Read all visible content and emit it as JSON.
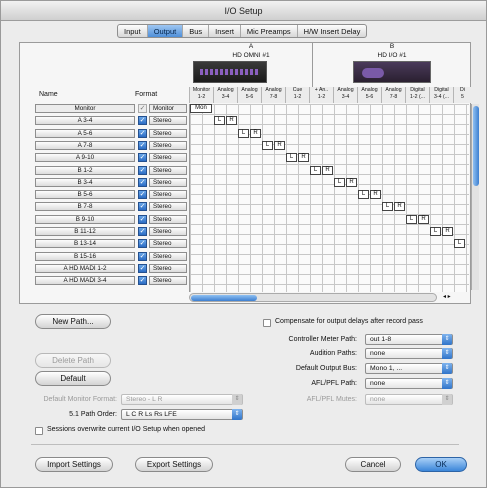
{
  "window": {
    "title": "I/O Setup"
  },
  "tabs": [
    {
      "label": "Input",
      "active": false
    },
    {
      "label": "Output",
      "active": true
    },
    {
      "label": "Bus",
      "active": false
    },
    {
      "label": "Insert",
      "active": false
    },
    {
      "label": "Mic Preamps",
      "active": false
    },
    {
      "label": "H/W Insert Delay",
      "active": false
    }
  ],
  "grid": {
    "name_header": "Name",
    "format_header": "Format",
    "devices": [
      {
        "letter": "A",
        "name": "HD OMNI #1"
      },
      {
        "letter": "B",
        "name": "HD I/O #1"
      }
    ],
    "channels": [
      {
        "l1": "Monitor",
        "l2": "1-2"
      },
      {
        "l1": "Analog",
        "l2": "3-4"
      },
      {
        "l1": "Analog",
        "l2": "5-6"
      },
      {
        "l1": "Analog",
        "l2": "7-8"
      },
      {
        "l1": "Cue",
        "l2": "1-2"
      },
      {
        "l1": "+ An..",
        "l2": "1-2"
      },
      {
        "l1": "Analog",
        "l2": "3-4"
      },
      {
        "l1": "Analog",
        "l2": "5-6"
      },
      {
        "l1": "Analog",
        "l2": "7-8"
      },
      {
        "l1": "Digital",
        "l2": "1-2 (..."
      },
      {
        "l1": "Digital",
        "l2": "3-4 (..."
      },
      {
        "l1": "Di",
        "l2": "5"
      }
    ],
    "rows": [
      {
        "name": "Monitor",
        "format": "Monitor",
        "checked": false,
        "header": true,
        "cells": [
          {
            "col": 0,
            "text": "Mon",
            "wide": true
          }
        ]
      },
      {
        "name": "A 3-4",
        "format": "Stereo",
        "checked": true,
        "cells": [
          {
            "col": 2,
            "text": "L"
          },
          {
            "col": 3,
            "text": "R"
          }
        ]
      },
      {
        "name": "A 5-6",
        "format": "Stereo",
        "checked": true,
        "cells": [
          {
            "col": 4,
            "text": "L"
          },
          {
            "col": 5,
            "text": "R"
          }
        ]
      },
      {
        "name": "A 7-8",
        "format": "Stereo",
        "checked": true,
        "cells": [
          {
            "col": 6,
            "text": "L"
          },
          {
            "col": 7,
            "text": "R"
          }
        ]
      },
      {
        "name": "A 9-10",
        "format": "Stereo",
        "checked": true,
        "cells": [
          {
            "col": 8,
            "text": "L"
          },
          {
            "col": 9,
            "text": "R"
          }
        ]
      },
      {
        "name": "B 1-2",
        "format": "Stereo",
        "checked": true,
        "cells": [
          {
            "col": 10,
            "text": "L"
          },
          {
            "col": 11,
            "text": "R"
          }
        ]
      },
      {
        "name": "B 3-4",
        "format": "Stereo",
        "checked": true,
        "cells": [
          {
            "col": 12,
            "text": "L"
          },
          {
            "col": 13,
            "text": "R"
          }
        ]
      },
      {
        "name": "B 5-6",
        "format": "Stereo",
        "checked": true,
        "cells": [
          {
            "col": 14,
            "text": "L"
          },
          {
            "col": 15,
            "text": "R"
          }
        ]
      },
      {
        "name": "B 7-8",
        "format": "Stereo",
        "checked": true,
        "cells": [
          {
            "col": 16,
            "text": "L"
          },
          {
            "col": 17,
            "text": "R"
          }
        ]
      },
      {
        "name": "B 9-10",
        "format": "Stereo",
        "checked": true,
        "cells": [
          {
            "col": 18,
            "text": "L"
          },
          {
            "col": 19,
            "text": "R"
          }
        ]
      },
      {
        "name": "B 11-12",
        "format": "Stereo",
        "checked": true,
        "cells": [
          {
            "col": 20,
            "text": "L"
          },
          {
            "col": 21,
            "text": "R"
          }
        ]
      },
      {
        "name": "B 13-14",
        "format": "Stereo",
        "checked": true,
        "cells": [
          {
            "col": 22,
            "text": "L"
          }
        ]
      },
      {
        "name": "B 15-16",
        "format": "Stereo",
        "checked": true,
        "cells": []
      },
      {
        "name": "A HD MADI 1-2",
        "format": "Stereo",
        "checked": true,
        "cells": []
      },
      {
        "name": "A HD MADI 3-4",
        "format": "Stereo",
        "checked": true,
        "cells": []
      }
    ]
  },
  "buttons": {
    "new_path": "New Path...",
    "delete_path": "Delete Path",
    "default": "Default",
    "import": "Import Settings",
    "export": "Export Settings",
    "cancel": "Cancel",
    "ok": "OK"
  },
  "options": {
    "compensate_label": "Compensate for output delays after record pass",
    "default_monitor_format_label": "Default Monitor Format:",
    "default_monitor_format_value": "Stereo - L R",
    "path_order_label": "5.1 Path Order:",
    "path_order_value": "L C R Ls Rs LFE",
    "sessions_overwrite_label": "Sessions overwrite current I/O Setup when opened",
    "controller_meter_label": "Controller Meter Path:",
    "controller_meter_value": "out 1-8",
    "audition_label": "Audition Paths:",
    "audition_value": "none",
    "default_output_label": "Default Output Bus:",
    "default_output_value": "Mono 1, ...",
    "afl_pfl_path_label": "AFL/PFL Path:",
    "afl_pfl_path_value": "none",
    "afl_pfl_mutes_label": "AFL/PFL Mutes:",
    "afl_pfl_mutes_value": "none"
  },
  "icons": {
    "check": "checkmark-icon",
    "popup_arrow": "popup-arrows-icon"
  }
}
